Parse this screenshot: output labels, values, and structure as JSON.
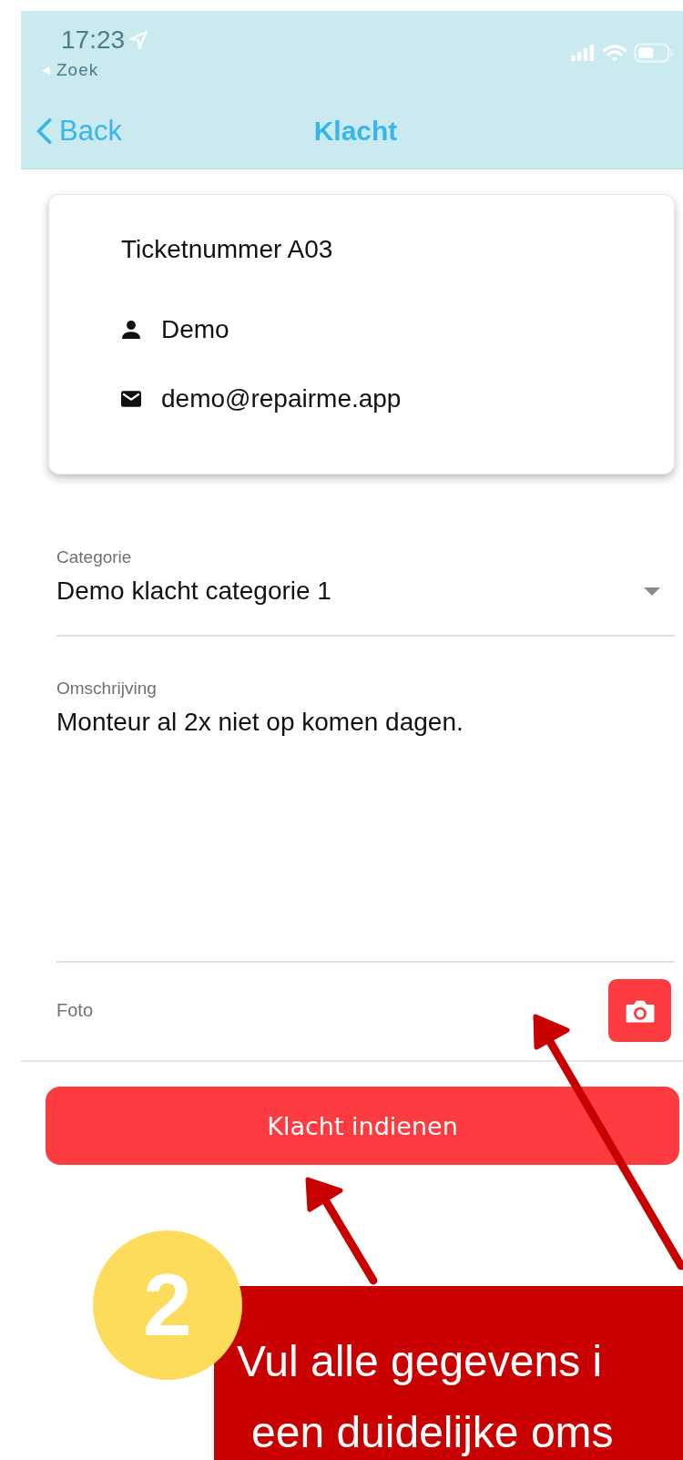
{
  "status_bar": {
    "time": "17:23",
    "back_app": "Zoek"
  },
  "nav": {
    "back_label": "Back",
    "title": "Klacht"
  },
  "ticket": {
    "title": "Ticketnummer A03",
    "name": "Demo",
    "email": "demo@repairme.app"
  },
  "fields": [
    {
      "kind": "dropdown",
      "label": "Categorie",
      "value": "Demo klacht categorie 1"
    },
    {
      "kind": "textarea",
      "label": "Omschrijving",
      "value": "Monteur al 2x niet op komen dagen."
    }
  ],
  "photo": {
    "label": "Foto"
  },
  "submit_button": "Klacht indienen",
  "annotation": {
    "step": "2",
    "lines": [
      "Vul alle gegevens i",
      "een duidelijke oms"
    ]
  }
}
